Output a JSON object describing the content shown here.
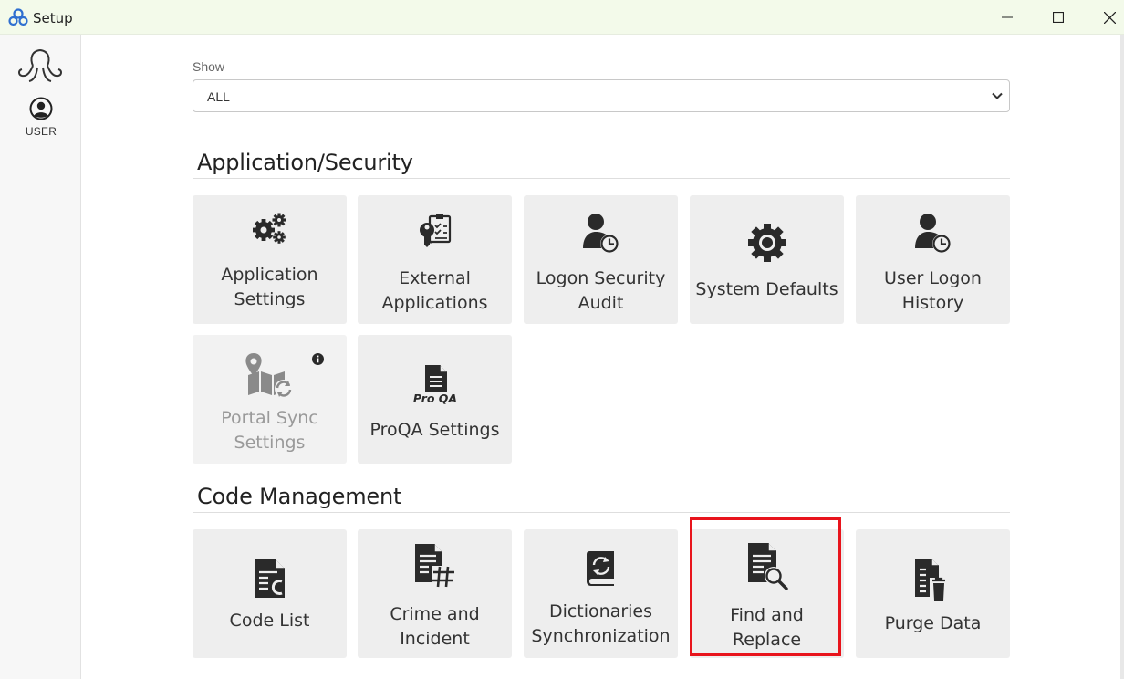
{
  "window": {
    "title": "Setup"
  },
  "sidebar": {
    "user_label": "USER"
  },
  "filter": {
    "label": "Show",
    "value": "ALL"
  },
  "sections": [
    {
      "title": "Application/Security",
      "tiles": [
        {
          "label": "Application\nSettings",
          "icon": "gears-icon"
        },
        {
          "label": "External\nApplications",
          "icon": "key-document-icon"
        },
        {
          "label": "Logon Security\nAudit",
          "icon": "user-clock-icon"
        },
        {
          "label": "System Defaults",
          "icon": "gear-icon"
        },
        {
          "label": "User Logon\nHistory",
          "icon": "user-clock-icon"
        },
        {
          "label": "Portal Sync\nSettings",
          "icon": "map-sync-icon",
          "disabled": true
        },
        {
          "label": "ProQA Settings",
          "icon": "proqa-document-icon",
          "icon_text": "Pro QA"
        }
      ]
    },
    {
      "title": "Code Management",
      "tiles": [
        {
          "label": "Code List",
          "icon": "code-list-icon"
        },
        {
          "label": "Crime and\nIncident",
          "icon": "document-hash-icon"
        },
        {
          "label": "Dictionaries\nSynchronization",
          "icon": "dictionary-sync-icon"
        },
        {
          "label": "Find and\nReplace",
          "icon": "document-search-icon",
          "highlighted": true
        },
        {
          "label": "Purge Data",
          "icon": "document-trash-icon"
        }
      ]
    }
  ]
}
